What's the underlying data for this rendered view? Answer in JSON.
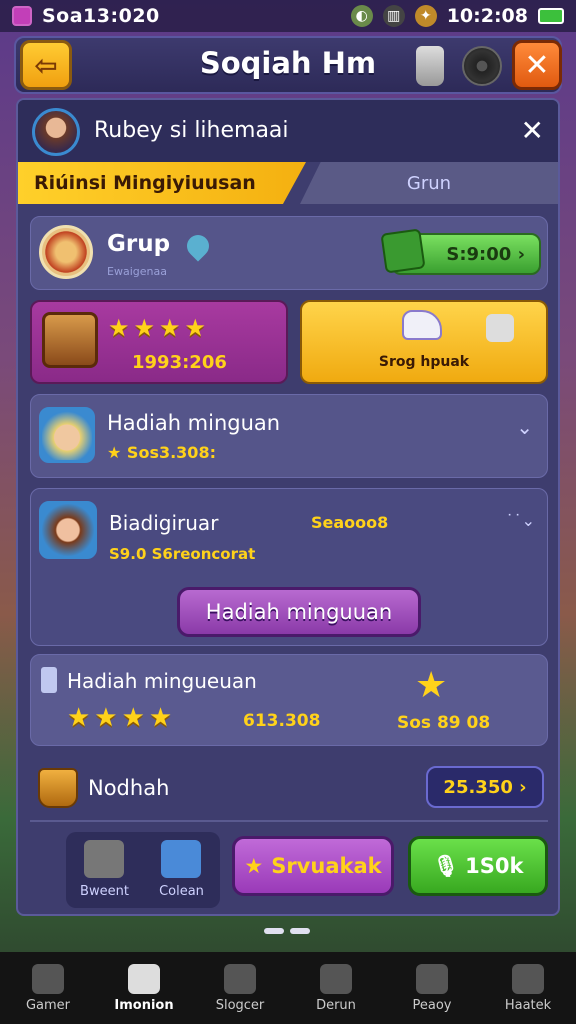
{
  "status": {
    "left": "Soa13:020",
    "time": "10:2:08"
  },
  "header": {
    "title": "Soqiah Hm"
  },
  "subheader": {
    "title": "Rubey si lihemaai"
  },
  "tabs": [
    {
      "label": "Riúinsi Mingiyiuusan"
    },
    {
      "label": "Grun"
    }
  ],
  "group": {
    "title": "Grup",
    "subtitle": "Ewaigenaa",
    "button": "S:9:00"
  },
  "reward_a": {
    "stars": "★★★★",
    "value": "1993:206"
  },
  "reward_b": {
    "label": "Srog hpuak"
  },
  "weekly": {
    "title": "Hadiah minguan",
    "value": "Sos3.308:"
  },
  "member": {
    "title": "Biadigiruar",
    "tag": "Seaooo8",
    "sub": "S9.0 S6reoncorat",
    "button": "Hadiah minguuan"
  },
  "weekly2": {
    "title": "Hadiah mingueuan",
    "stars": "★★★★",
    "value1": "613.308",
    "value2": "Sos 89 08"
  },
  "bucket": {
    "title": "Nodhah",
    "button": "25.350"
  },
  "actions": {
    "tile1": "Bweent",
    "tile2": "Colean",
    "violet": "Srvuakak",
    "green": "1S0k"
  },
  "nav": [
    {
      "label": "Gamer"
    },
    {
      "label": "Imonion"
    },
    {
      "label": "Slogcer"
    },
    {
      "label": "Derun"
    },
    {
      "label": "Peaoy"
    },
    {
      "label": "Haatek"
    }
  ]
}
